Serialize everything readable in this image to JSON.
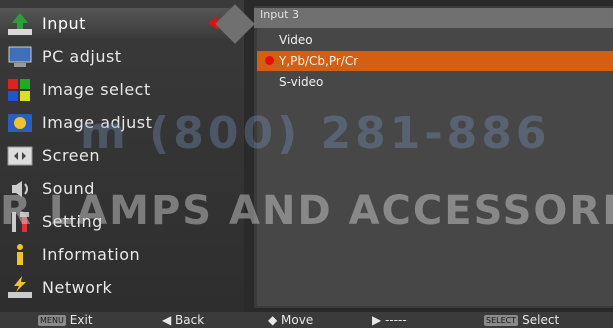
{
  "menu": {
    "items": [
      {
        "label": "Input",
        "icon": "input-icon",
        "selected": true
      },
      {
        "label": "PC adjust",
        "icon": "pc-adjust-icon"
      },
      {
        "label": "Image select",
        "icon": "image-select-icon"
      },
      {
        "label": "Image adjust",
        "icon": "image-adjust-icon"
      },
      {
        "label": "Screen",
        "icon": "screen-icon"
      },
      {
        "label": "Sound",
        "icon": "sound-icon"
      },
      {
        "label": "Setting",
        "icon": "setting-icon"
      },
      {
        "label": "Information",
        "icon": "information-icon"
      },
      {
        "label": "Network",
        "icon": "network-icon"
      }
    ]
  },
  "submenu": {
    "title": "Input 3",
    "items": [
      {
        "label": "Video"
      },
      {
        "label": "Y,Pb/Cb,Pr/Cr",
        "selected": true
      },
      {
        "label": "S-video"
      }
    ]
  },
  "bottom": {
    "exit_key": "MENU",
    "exit_label": "Exit",
    "back_label": "◀ Back",
    "move_label": "◆ Move",
    "next_label": "▶ -----",
    "select_key": "SELECT",
    "select_label": "Select"
  },
  "watermark": {
    "phone": "m (800) 281-886",
    "text": "R LAMPS AND ACCESSORIES"
  },
  "colors": {
    "selected_item": "#d35f12",
    "indicator": "#e01010"
  }
}
